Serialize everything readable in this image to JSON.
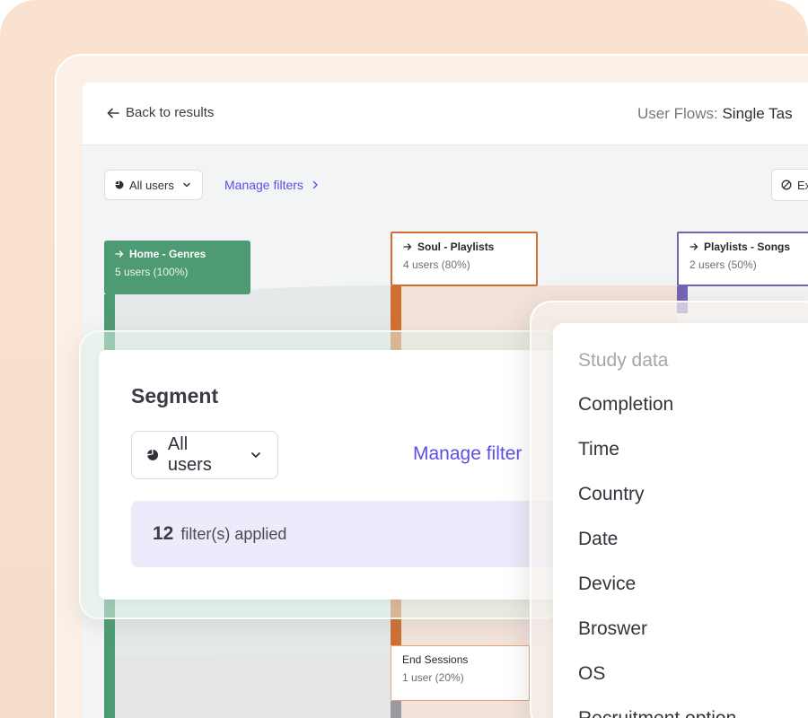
{
  "header": {
    "back_label": "Back to results",
    "title_prefix": "User Flows: ",
    "title_strong": "Single Tas"
  },
  "toolbar": {
    "segment_label": "All users",
    "manage_label": "Manage filters",
    "ex_label": "Ex"
  },
  "flow": {
    "nodes": [
      {
        "title": "Home - Genres",
        "subtitle": "5 users (100%)",
        "color": "#4e9a72"
      },
      {
        "title": "Soul - Playlists",
        "subtitle": "4 users (80%)",
        "color": "#d16f31"
      },
      {
        "title": "Playlists - Songs",
        "subtitle": "2 users (50%)",
        "color": "#7364b4"
      },
      {
        "title": "End Sessions",
        "subtitle": "1 user (20%)",
        "color": "#e0a57e"
      }
    ]
  },
  "segment_card": {
    "title": "Segment",
    "dropdown_label": "All users",
    "manage_label": "Manage filter",
    "filters_count": "12",
    "filters_text": "filter(s) applied"
  },
  "study_data": {
    "heading": "Study data",
    "items": [
      "Completion",
      "Time",
      "Country",
      "Date",
      "Device",
      "Broswer",
      "OS",
      "Recruitment option"
    ]
  },
  "colors": {
    "accent": "#5b4fe8",
    "home_green": "#4e9a72",
    "soul_orange": "#d16f31",
    "playlist_purple": "#7364b4",
    "filters_bg": "#ecebfb"
  }
}
